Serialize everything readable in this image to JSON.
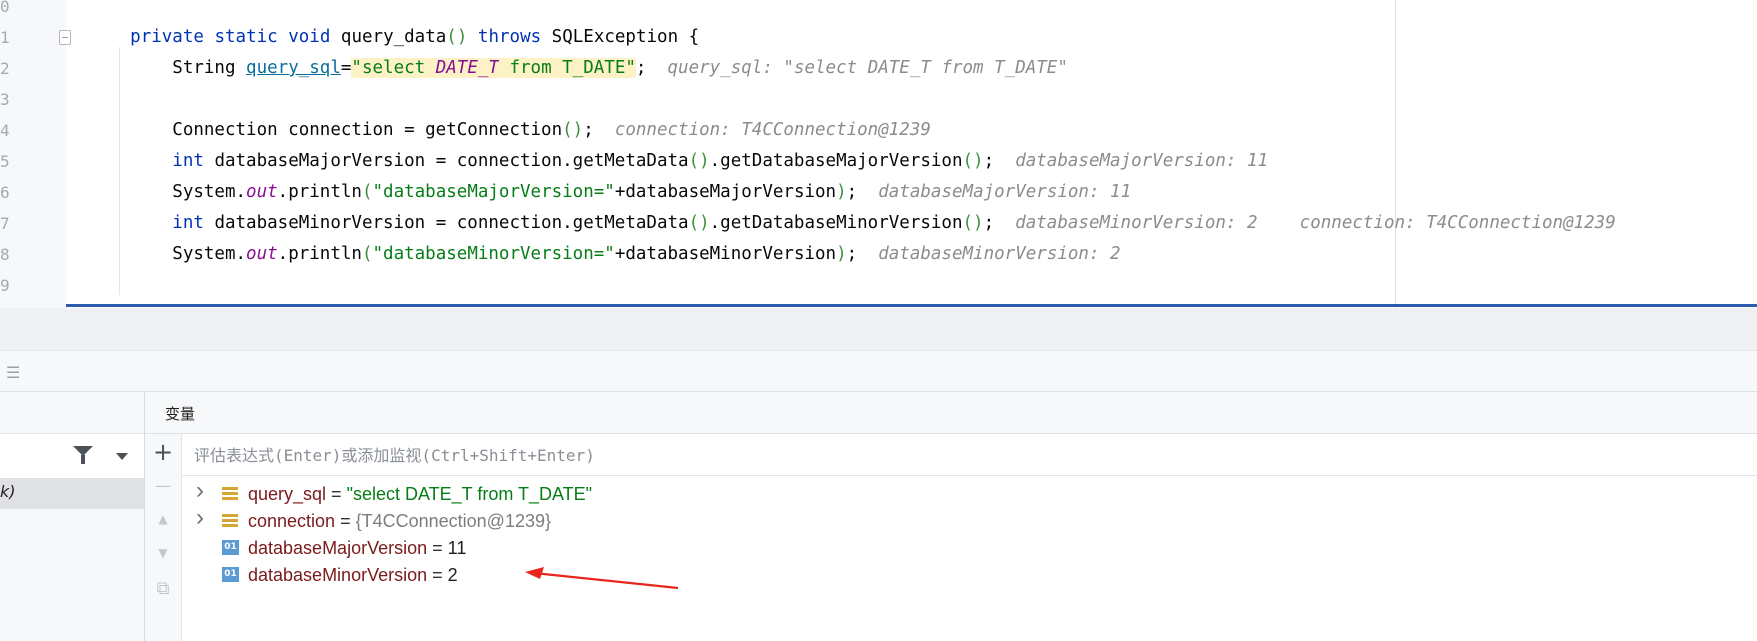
{
  "editor": {
    "line_numbers": [
      "0",
      "1",
      "2",
      "3",
      "4",
      "5",
      "6",
      "7",
      "8",
      "9"
    ],
    "lines": [
      {
        "tokens": []
      },
      {
        "tokens": [
          {
            "t": "    ",
            "c": ""
          },
          {
            "t": "private",
            "c": "kw"
          },
          {
            "t": " ",
            "c": ""
          },
          {
            "t": "static",
            "c": "kw"
          },
          {
            "t": " ",
            "c": ""
          },
          {
            "t": "void",
            "c": "kw"
          },
          {
            "t": " query_data",
            "c": ""
          },
          {
            "t": "()",
            "c": "paren"
          },
          {
            "t": " ",
            "c": ""
          },
          {
            "t": "throws",
            "c": "kw"
          },
          {
            "t": " SQLException {",
            "c": ""
          }
        ]
      },
      {
        "tokens": [
          {
            "t": "        String ",
            "c": ""
          },
          {
            "t": "query_sql",
            "c": "var-u"
          },
          {
            "t": "=",
            "c": ""
          },
          {
            "t": "\"select ",
            "c": "str str-hl"
          },
          {
            "t": "DATE_T",
            "c": "str str-hl it"
          },
          {
            "t": " from T_DATE\"",
            "c": "str str-hl"
          },
          {
            "t": ";  ",
            "c": ""
          },
          {
            "t": "query_sql: \"select DATE_T from T_DATE\"",
            "c": "hint"
          }
        ]
      },
      {
        "tokens": []
      },
      {
        "tokens": [
          {
            "t": "        Connection connection = getConnection",
            "c": ""
          },
          {
            "t": "()",
            "c": "paren"
          },
          {
            "t": ";  ",
            "c": ""
          },
          {
            "t": "connection: T4CConnection@1239",
            "c": "hint"
          }
        ]
      },
      {
        "tokens": [
          {
            "t": "        ",
            "c": ""
          },
          {
            "t": "int",
            "c": "kw"
          },
          {
            "t": " databaseMajorVersion = connection.getMetaData",
            "c": ""
          },
          {
            "t": "()",
            "c": "paren"
          },
          {
            "t": ".getDatabaseMajorVersion",
            "c": ""
          },
          {
            "t": "()",
            "c": "paren"
          },
          {
            "t": ";  ",
            "c": ""
          },
          {
            "t": "databaseMajorVersion: 11",
            "c": "hint"
          }
        ]
      },
      {
        "tokens": [
          {
            "t": "        System.",
            "c": ""
          },
          {
            "t": "out",
            "c": "it"
          },
          {
            "t": ".println",
            "c": ""
          },
          {
            "t": "(",
            "c": "paren"
          },
          {
            "t": "\"databaseMajorVersion=\"",
            "c": "str"
          },
          {
            "t": "+databaseMajorVersion",
            "c": ""
          },
          {
            "t": ")",
            "c": "paren"
          },
          {
            "t": ";  ",
            "c": ""
          },
          {
            "t": "databaseMajorVersion: 11",
            "c": "hint"
          }
        ]
      },
      {
        "tokens": [
          {
            "t": "        ",
            "c": ""
          },
          {
            "t": "int",
            "c": "kw"
          },
          {
            "t": " databaseMinorVersion = connection.getMetaData",
            "c": ""
          },
          {
            "t": "()",
            "c": "paren"
          },
          {
            "t": ".getDatabaseMinorVersion",
            "c": ""
          },
          {
            "t": "()",
            "c": "paren"
          },
          {
            "t": ";  ",
            "c": ""
          },
          {
            "t": "databaseMinorVersion: 2    connection: T4CConnection@1239",
            "c": "hint"
          }
        ]
      },
      {
        "tokens": [
          {
            "t": "        System.",
            "c": ""
          },
          {
            "t": "out",
            "c": "it"
          },
          {
            "t": ".println",
            "c": ""
          },
          {
            "t": "(",
            "c": "paren"
          },
          {
            "t": "\"databaseMinorVersion=\"",
            "c": "str"
          },
          {
            "t": "+databaseMinorVersion",
            "c": ""
          },
          {
            "t": ")",
            "c": "paren"
          },
          {
            "t": ";  ",
            "c": ""
          },
          {
            "t": "databaseMinorVersion: 2",
            "c": "hint"
          }
        ]
      },
      {
        "tokens": []
      }
    ]
  },
  "frames": {
    "current_frame_label": "k)"
  },
  "variables_panel": {
    "title": "变量",
    "eval_placeholder": "评估表达式(Enter)或添加监视(Ctrl+Shift+Enter)",
    "tools": {
      "add": "+",
      "remove": "—",
      "up": "▲",
      "down": "▼",
      "copy": "⧉"
    },
    "items": [
      {
        "expandable": true,
        "icon": "string-field-icon",
        "name": "query_sql",
        "eq": " = ",
        "value": "\"select DATE_T from T_DATE\"",
        "value_style": "vstr"
      },
      {
        "expandable": true,
        "icon": "object-field-icon",
        "name": "connection",
        "eq": " = ",
        "value": "{T4CConnection@1239}",
        "value_style": "vobj"
      },
      {
        "expandable": false,
        "icon": "int-field-icon",
        "icon_text": "01",
        "name": "databaseMajorVersion",
        "eq": " = ",
        "value": "11",
        "value_style": "vnum"
      },
      {
        "expandable": false,
        "icon": "int-field-icon",
        "icon_text": "01",
        "name": "databaseMinorVersion",
        "eq": " = ",
        "value": "2",
        "value_style": "vnum"
      }
    ]
  },
  "colors": {
    "keyword": "#0033b3",
    "string": "#067d17",
    "hint": "#8c8c8c",
    "annotation_arrow": "#e8261b",
    "editor_border": "#2d5bad"
  }
}
